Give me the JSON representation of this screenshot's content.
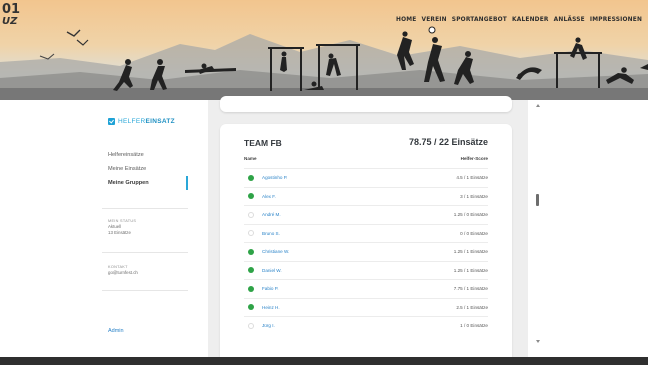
{
  "logo": {
    "line1": "01",
    "line2": "UZ"
  },
  "nav": [
    {
      "label": "HOME"
    },
    {
      "label": "VEREIN"
    },
    {
      "label": "SPORTANGEBOT"
    },
    {
      "label": "KALENDER"
    },
    {
      "label": "ANLÄSSE"
    },
    {
      "label": "IMPRESSIONEN"
    }
  ],
  "sidebar": {
    "brand": {
      "prefix": "HELFER",
      "suffix": "EINSATZ"
    },
    "menu": [
      {
        "label": "Helfereinsätze"
      },
      {
        "label": "Meine Einsätze"
      },
      {
        "label": "Meine Gruppen"
      }
    ],
    "status": {
      "key": "MEIN STATUS",
      "line1": "Aktuell",
      "line2": "13 Einsätze"
    },
    "kontakt": {
      "key": "KONTAKT",
      "email": "go@turnfest.ch"
    },
    "admin": "Admin"
  },
  "team": {
    "title": "TEAM FB",
    "total": "78.75 / 22 Einsätze",
    "col_name": "Name",
    "col_score": "Helfer-Score",
    "members": [
      {
        "name": "Agostinho P.",
        "score": "4.5 / 1 Einsätze",
        "active": true
      },
      {
        "name": "Alex F.",
        "score": "3 / 1 Einsätze",
        "active": true
      },
      {
        "name": "André M.",
        "score": "1.25 / 0 Einsätze",
        "active": false
      },
      {
        "name": "Bruno S.",
        "score": "0 / 0 Einsätze",
        "active": false
      },
      {
        "name": "Christiane W.",
        "score": "1.25 / 1 Einsätze",
        "active": true
      },
      {
        "name": "Daniel W.",
        "score": "1.25 / 1 Einsätze",
        "active": true
      },
      {
        "name": "Fabio P.",
        "score": "7.75 / 1 Einsätze",
        "active": true
      },
      {
        "name": "Heinz H.",
        "score": "2.5 / 1 Einsätze",
        "active": true
      },
      {
        "name": "Jürg I.",
        "score": "1 / 0 Einsätze",
        "active": false
      }
    ]
  },
  "colors": {
    "accent": "#2aa7d8",
    "active_dot": "#2ea347",
    "link": "#2a83c8",
    "footer": "#2f2f2f"
  }
}
